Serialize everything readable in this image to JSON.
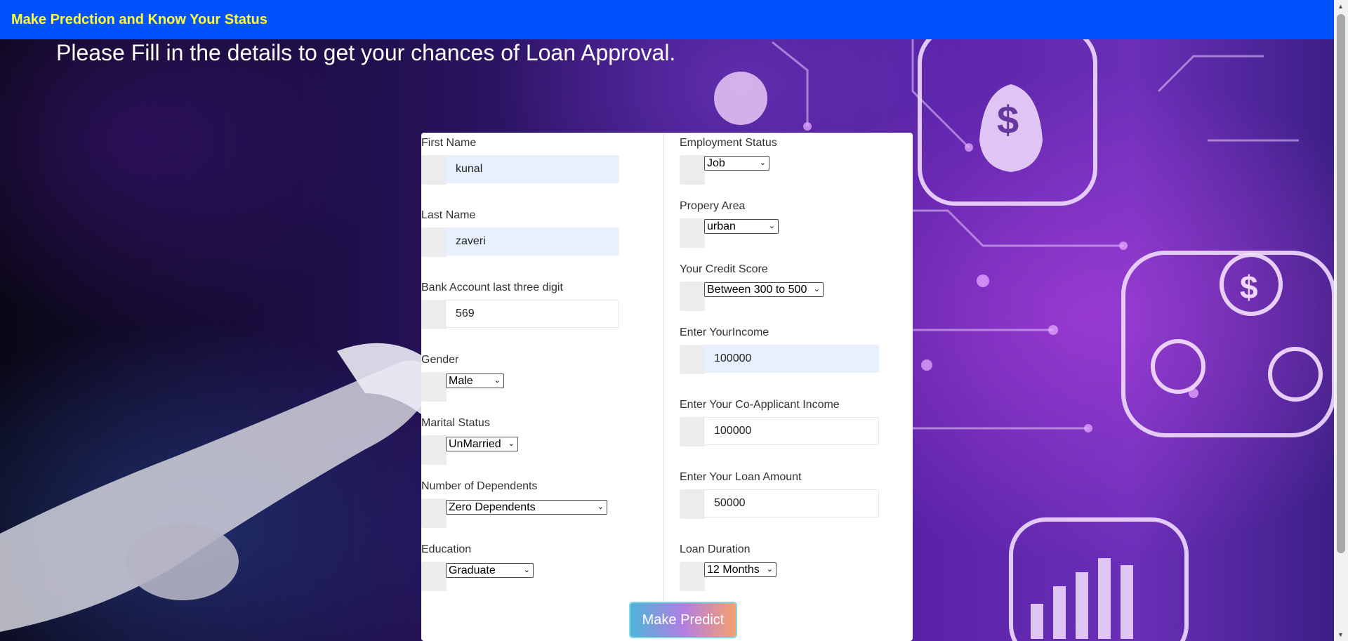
{
  "header": {
    "brand": "Make Predction and Know Your Status",
    "headline": "Please Fill in the details to get your chances of Loan Approval."
  },
  "form": {
    "first_name": {
      "label": "First Name",
      "value": "kunal"
    },
    "last_name": {
      "label": "Last Name",
      "value": "zaveri"
    },
    "bank_account": {
      "label": "Bank Account last three digit",
      "value": "569"
    },
    "gender": {
      "label": "Gender",
      "selected": "Male"
    },
    "marital_status": {
      "label": "Marital Status",
      "selected": "UnMarried"
    },
    "dependents": {
      "label": "Number of Dependents",
      "selected": "Zero Dependents"
    },
    "education": {
      "label": "Education",
      "selected": "Graduate"
    },
    "employment_status": {
      "label": "Employment Status",
      "selected": "Job"
    },
    "property_area": {
      "label": "Propery Area",
      "selected": "urban"
    },
    "credit_score": {
      "label": "Your Credit Score",
      "selected": "Between 300 to 500"
    },
    "income": {
      "label": "Enter YourIncome",
      "value": "100000"
    },
    "coapplicant_income": {
      "label": "Enter Your Co-Applicant Income",
      "value": "100000"
    },
    "loan_amount": {
      "label": "Enter Your Loan Amount",
      "value": "50000"
    },
    "loan_duration": {
      "label": "Loan Duration",
      "selected": "12 Months"
    }
  },
  "submit": {
    "label": "Make Predict"
  },
  "colors": {
    "topbar": "#0051ff",
    "brand_text": "#ffff33",
    "autofill_bg": "#e8f0fe"
  },
  "icons": {
    "chevron": "chevron-down-icon"
  }
}
